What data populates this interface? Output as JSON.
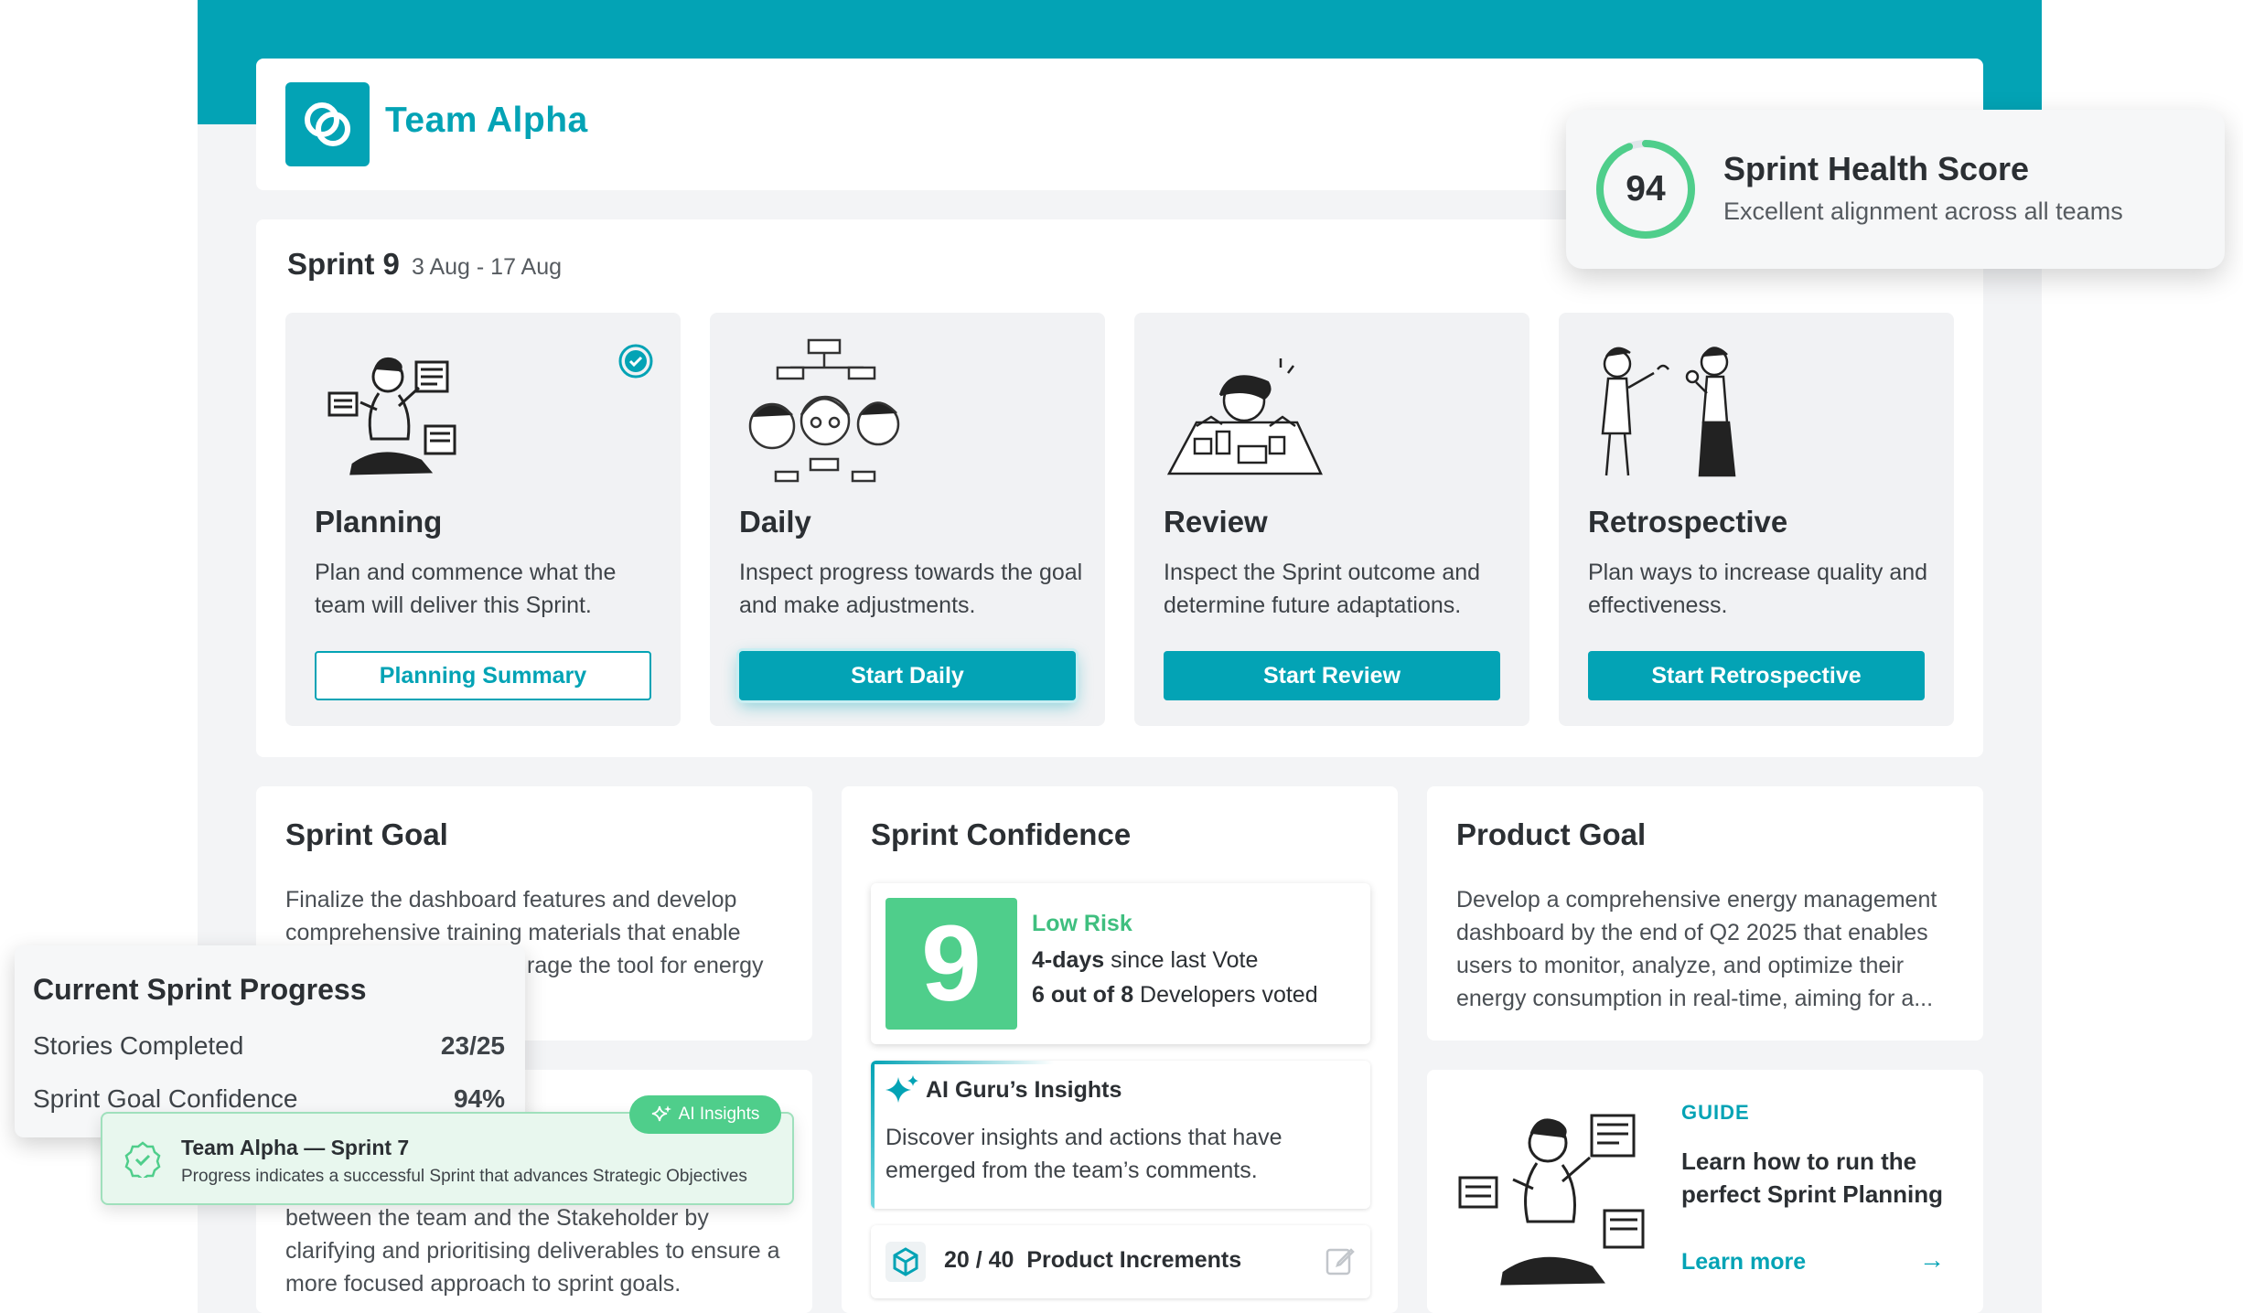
{
  "header": {
    "team_name": "Team Alpha"
  },
  "sprint": {
    "name": "Sprint 9",
    "dates": "3 Aug - 17 Aug"
  },
  "events": [
    {
      "name": "Planning",
      "description": "Plan and commence what the team will deliver this Sprint.",
      "button": "Planning Summary",
      "completed": true
    },
    {
      "name": "Daily",
      "description": "Inspect progress towards the goal and make adjustments.",
      "button": "Start Daily"
    },
    {
      "name": "Review",
      "description": "Inspect the Sprint outcome and determine future adaptations.",
      "button": "Start Review"
    },
    {
      "name": "Retrospective",
      "description": "Plan ways to increase quality and effectiveness.",
      "button": "Start Retrospective"
    }
  ],
  "sprint_goal": {
    "title": "Sprint Goal",
    "text": "Finalize the dashboard features and develop comprehensive training materials that enable",
    "text_tail": "rage the tool for energy",
    "lower_text": "between the team and the Stakeholder by clarifying and prioritising deliverables to ensure a more focused approach to sprint goals."
  },
  "sprint_confidence": {
    "title": "Sprint Confidence",
    "score": "9",
    "risk": "Low Risk",
    "vote_days": "4-days",
    "vote_suffix": " since last Vote",
    "voted_count": "6 out of 8",
    "voted_suffix": " Developers voted"
  },
  "ai_guru": {
    "title": "AI Guru’s Insights",
    "text": "Discover insights and actions that have emerged from the team’s comments."
  },
  "increments": {
    "count": "20 / 40",
    "label": "Product Increments"
  },
  "product_goal": {
    "title": "Product Goal",
    "text": "Develop a comprehensive energy management dashboard by the end of Q2 2025 that enables users to monitor, analyze, and optimize their energy consumption in real-time, aiming for a..."
  },
  "guide": {
    "label": "GUIDE",
    "text": "Learn how to run the perfect Sprint Planning",
    "link": "Learn more"
  },
  "health": {
    "score": "94",
    "title": "Sprint Health Score",
    "subtitle": "Excellent alignment across all teams"
  },
  "progress": {
    "title": "Current Sprint Progress",
    "rows": [
      {
        "label": "Stories Completed",
        "value": "23/25"
      },
      {
        "label": "Sprint Goal Confidence",
        "value": "94%"
      }
    ]
  },
  "toast": {
    "title": "Team Alpha — Sprint 7",
    "subtitle": "Progress indicates a successful Sprint that advances Strategic Objectives",
    "pill": "AI Insights"
  },
  "colors": {
    "accent": "#03a3b5",
    "success": "#4fce8b"
  }
}
